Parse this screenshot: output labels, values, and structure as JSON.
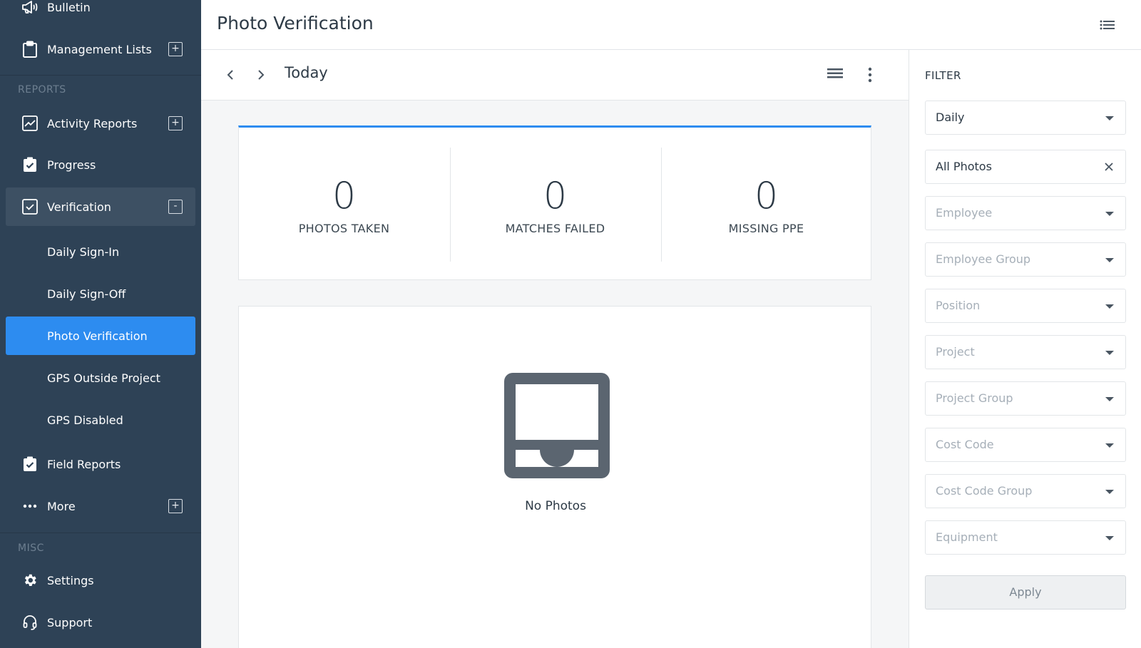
{
  "app": {
    "page_title": "Photo Verification"
  },
  "sidebar": {
    "items_top": [
      {
        "key": "bulletin",
        "label": "Bulletin"
      },
      {
        "key": "management-lists",
        "label": "Management Lists",
        "expand": "+"
      }
    ],
    "section_reports": "REPORTS",
    "reports": [
      {
        "key": "activity-reports",
        "label": "Activity Reports",
        "expand": "+"
      },
      {
        "key": "progress",
        "label": "Progress"
      },
      {
        "key": "verification",
        "label": "Verification",
        "expand": "-"
      }
    ],
    "verification_subitems": [
      {
        "key": "daily-sign-in",
        "label": "Daily Sign-In"
      },
      {
        "key": "daily-sign-off",
        "label": "Daily Sign-Off"
      },
      {
        "key": "photo-verification",
        "label": "Photo Verification",
        "active": true
      },
      {
        "key": "gps-outside-project",
        "label": "GPS Outside Project"
      },
      {
        "key": "gps-disabled",
        "label": "GPS Disabled"
      }
    ],
    "reports_more": [
      {
        "key": "field-reports",
        "label": "Field Reports"
      },
      {
        "key": "more",
        "label": "More",
        "expand": "+"
      }
    ],
    "section_misc": "MISC",
    "misc": [
      {
        "key": "settings",
        "label": "Settings"
      },
      {
        "key": "support",
        "label": "Support"
      }
    ]
  },
  "toolbar": {
    "date_label": "Today",
    "prev_icon": "chevron-left-icon",
    "next_icon": "chevron-right-icon",
    "view_icon": "list-view-icon",
    "more_icon": "kebab-menu-icon"
  },
  "stats": [
    {
      "value": "0",
      "label": "PHOTOS TAKEN"
    },
    {
      "value": "0",
      "label": "MATCHES FAILED"
    },
    {
      "value": "0",
      "label": "MISSING PPE"
    }
  ],
  "photos": {
    "empty_text": "No Photos",
    "empty_icon": "inbox-icon"
  },
  "filter": {
    "title": "FILTER",
    "period": "Daily",
    "photo_type": "All Photos",
    "placeholders": {
      "employee": "Employee",
      "employee_group": "Employee Group",
      "position": "Position",
      "project": "Project",
      "project_group": "Project Group",
      "cost_code": "Cost Code",
      "cost_code_group": "Cost Code Group",
      "equipment": "Equipment"
    },
    "apply_label": "Apply"
  },
  "colors": {
    "sidebar_bg": "#2e4256",
    "accent": "#2d8cf0",
    "icon_gray": "#5b6570"
  }
}
